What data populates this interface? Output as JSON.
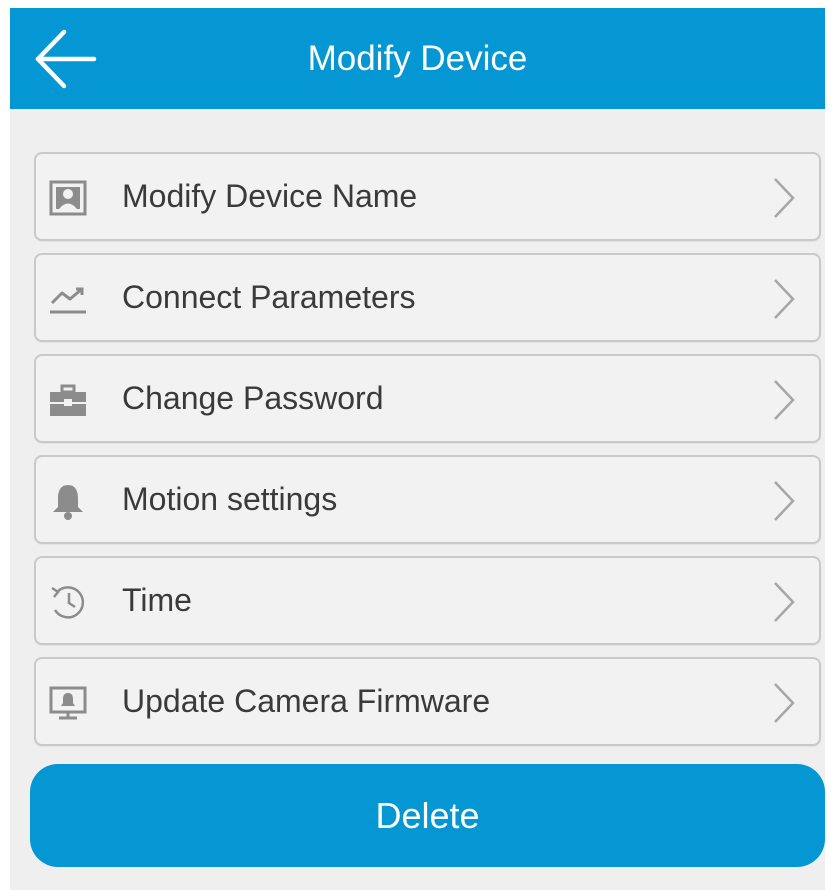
{
  "header": {
    "title": "Modify Device",
    "back_icon": "arrow-left-icon",
    "background_color": "#0597d3"
  },
  "menu": {
    "items": [
      {
        "label": "Modify Device Name",
        "icon": "id-card-icon"
      },
      {
        "label": "Connect Parameters",
        "icon": "trend-chart-icon"
      },
      {
        "label": "Change Password",
        "icon": "briefcase-icon"
      },
      {
        "label": "Motion settings",
        "icon": "bell-icon"
      },
      {
        "label": "Time",
        "icon": "clock-icon"
      },
      {
        "label": "Update Camera Firmware",
        "icon": "monitor-icon"
      }
    ],
    "chevron_icon": "chevron-right-icon"
  },
  "actions": {
    "delete_label": "Delete"
  },
  "colors": {
    "accent": "#0597d3",
    "background": "#efefef",
    "item_background": "#f2f2f2",
    "item_border": "#c9c9c9",
    "text": "#3a3a3a",
    "icon": "#8c8c8c"
  }
}
